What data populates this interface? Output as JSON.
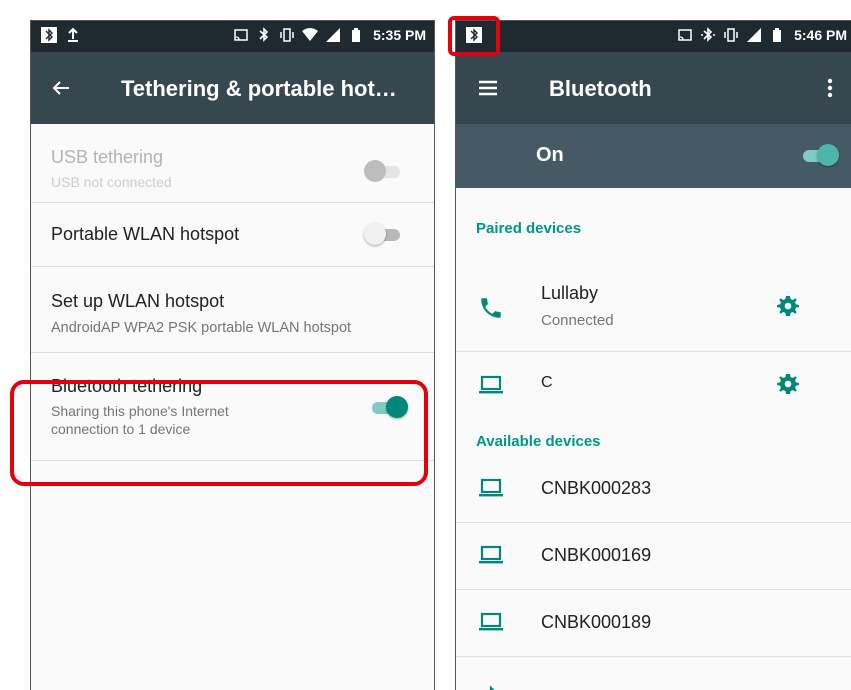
{
  "left_screen": {
    "status_bar": {
      "left_icons": [
        "bluetooth-icon",
        "upload-icon"
      ],
      "right_icons": [
        "cast-icon",
        "bluetooth-icon",
        "vibrate-icon",
        "wifi-icon",
        "signal-icon",
        "battery-icon"
      ],
      "time": "5:35 PM"
    },
    "toolbar": {
      "title": "Tethering & portable hot…",
      "back_icon": "arrow-back-icon"
    },
    "items": [
      {
        "title": "USB tethering",
        "subtitle": "USB not connected",
        "enabled": false,
        "checked": false
      },
      {
        "title": "Portable WLAN hotspot",
        "enabled": true,
        "checked": false
      },
      {
        "title": "Set up WLAN hotspot",
        "subtitle": "AndroidAP WPA2 PSK portable WLAN hotspot"
      },
      {
        "title": "Bluetooth tethering",
        "subtitle_line1": "Sharing this phone's Internet",
        "subtitle_line2": "connection to 1 device",
        "enabled": true,
        "checked": true
      }
    ]
  },
  "right_screen": {
    "status_bar": {
      "left_icons": [
        "bluetooth-icon"
      ],
      "right_icons": [
        "cast-icon",
        "bluetooth-icon",
        "vibrate-icon",
        "signal-icon",
        "battery-icon"
      ],
      "time": "5:46 PM"
    },
    "toolbar": {
      "title": "Bluetooth",
      "menu_icon": "hamburger-menu-icon",
      "overflow_icon": "more-vert-icon"
    },
    "master_switch": {
      "label": "On",
      "checked": true
    },
    "paired_header": "Paired devices",
    "paired_devices": [
      {
        "name": "Lullaby",
        "status": "Connected",
        "icon": "phone-icon"
      },
      {
        "name": "C",
        "icon": "laptop-icon"
      }
    ],
    "available_header": "Available devices",
    "available_devices": [
      {
        "name": "CNBK000283",
        "icon": "laptop-icon"
      },
      {
        "name": "CNBK000169",
        "icon": "laptop-icon"
      },
      {
        "name": "CNBK000189",
        "icon": "laptop-icon"
      }
    ]
  },
  "colors": {
    "accent": "#009688",
    "toolbar": "#37474f",
    "status_bar": "#1f2a30",
    "master_bar": "#455a64",
    "highlight": "#e3000b"
  }
}
